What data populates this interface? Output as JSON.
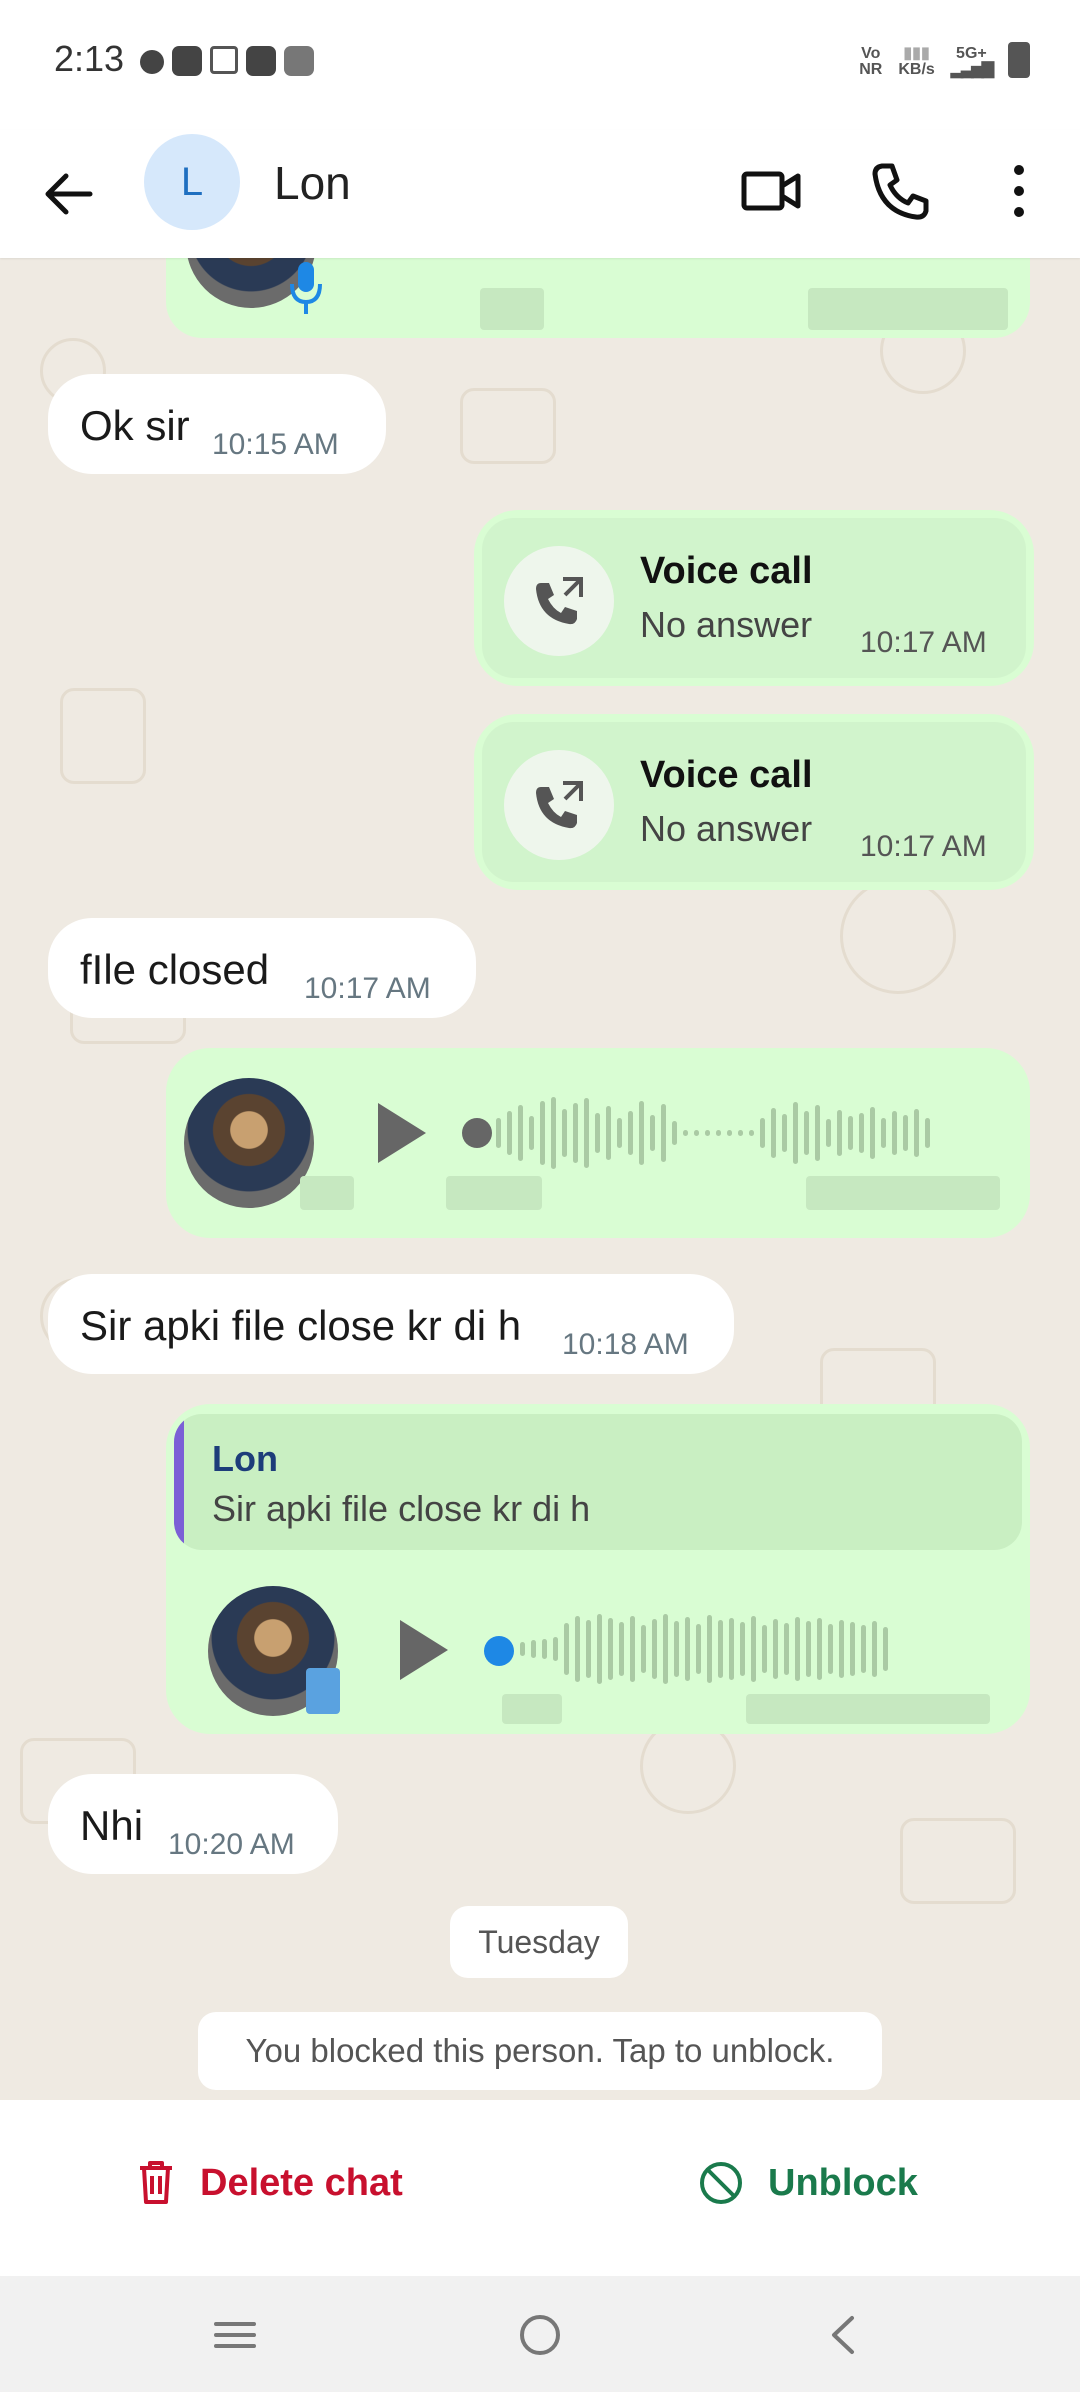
{
  "status_bar": {
    "time": "2:13",
    "network_right": [
      "Vo",
      "NR",
      "KB/s",
      "5G+"
    ]
  },
  "header": {
    "avatar_letter": "L",
    "contact_name": "Lon"
  },
  "messages": {
    "m1": {
      "text": "Ok sir",
      "time": "10:15 AM"
    },
    "call1": {
      "title": "Voice call",
      "subtitle": "No answer",
      "time": "10:17 AM"
    },
    "call2": {
      "title": "Voice call",
      "subtitle": "No answer",
      "time": "10:17 AM"
    },
    "m2": {
      "text": "fIle closed",
      "time": "10:17 AM"
    },
    "m3": {
      "text": "Sir apki file close kr di h",
      "time": "10:18 AM"
    },
    "reply": {
      "quoted_name": "Lon",
      "quoted_text": "Sir apki file close kr di h"
    },
    "m4": {
      "text": "Nhi",
      "time": "10:20 AM"
    }
  },
  "date_divider": "Tuesday",
  "system_notice": "You blocked this person. Tap to unblock.",
  "actions": {
    "delete_label": "Delete chat",
    "unblock_label": "Unblock"
  },
  "colors": {
    "delete": "#c8102e",
    "unblock": "#1a7a4c",
    "outgoing_bubble": "#d9fdd3",
    "chat_bg": "#efeae2"
  }
}
